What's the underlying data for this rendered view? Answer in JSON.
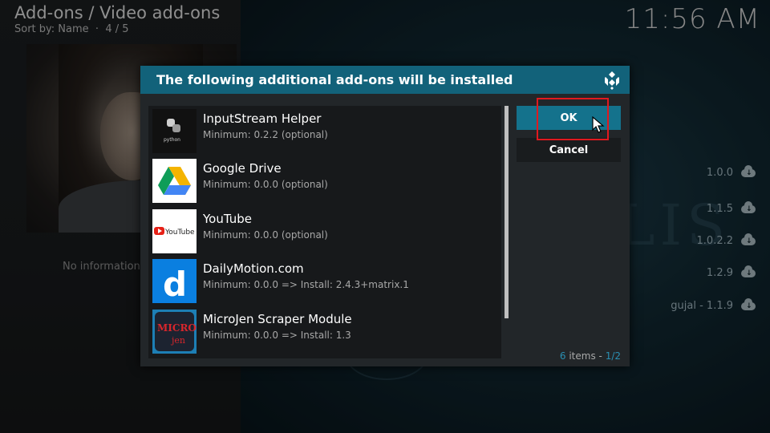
{
  "header": {
    "title": "Add-ons / Video add-ons",
    "sort": "Sort by: Name",
    "position": "4 / 5",
    "clock": "11:56 AM"
  },
  "background": {
    "no_info": "No information a",
    "logo_text": "LIS",
    "versions": [
      {
        "label": "1.0.0",
        "icon": "cloud-download-icon"
      },
      {
        "label": "1.1.5",
        "icon": "cloud-download-icon"
      },
      {
        "label": "1.0.2.2",
        "icon": "cloud-download-icon"
      },
      {
        "label": "1.2.9",
        "icon": "cloud-download-icon"
      },
      {
        "label": "gujal - 1.1.9",
        "icon": "cloud-download-icon"
      }
    ]
  },
  "dialog": {
    "title": "The following additional add-ons will be installed",
    "ok_label": "OK",
    "cancel_label": "Cancel",
    "items_count": "6",
    "items_word": "items",
    "page": "1/2",
    "items": [
      {
        "name": "InputStream Helper",
        "sub": "Minimum: 0.2.2 (optional)",
        "icon": "python-icon"
      },
      {
        "name": "Google Drive",
        "sub": "Minimum: 0.0.0 (optional)",
        "icon": "google-drive-icon"
      },
      {
        "name": "YouTube",
        "sub": "Minimum: 0.0.0 (optional)",
        "icon": "youtube-icon"
      },
      {
        "name": "DailyMotion.com",
        "sub": "Minimum: 0.0.0 => Install: 2.4.3+matrix.1",
        "icon": "dailymotion-icon"
      },
      {
        "name": "MicroJen Scraper Module",
        "sub": "Minimum: 0.0.0 => Install: 1.3",
        "icon": "microjen-icon"
      }
    ],
    "thumb_text": {
      "python": "python",
      "youtube": "YouTube",
      "dailymotion": "d",
      "micro_top": "MICRO",
      "micro_bottom": "jen"
    }
  },
  "colors": {
    "accent": "#14728c",
    "header": "#12627a",
    "highlight_box": "#e0191f"
  }
}
